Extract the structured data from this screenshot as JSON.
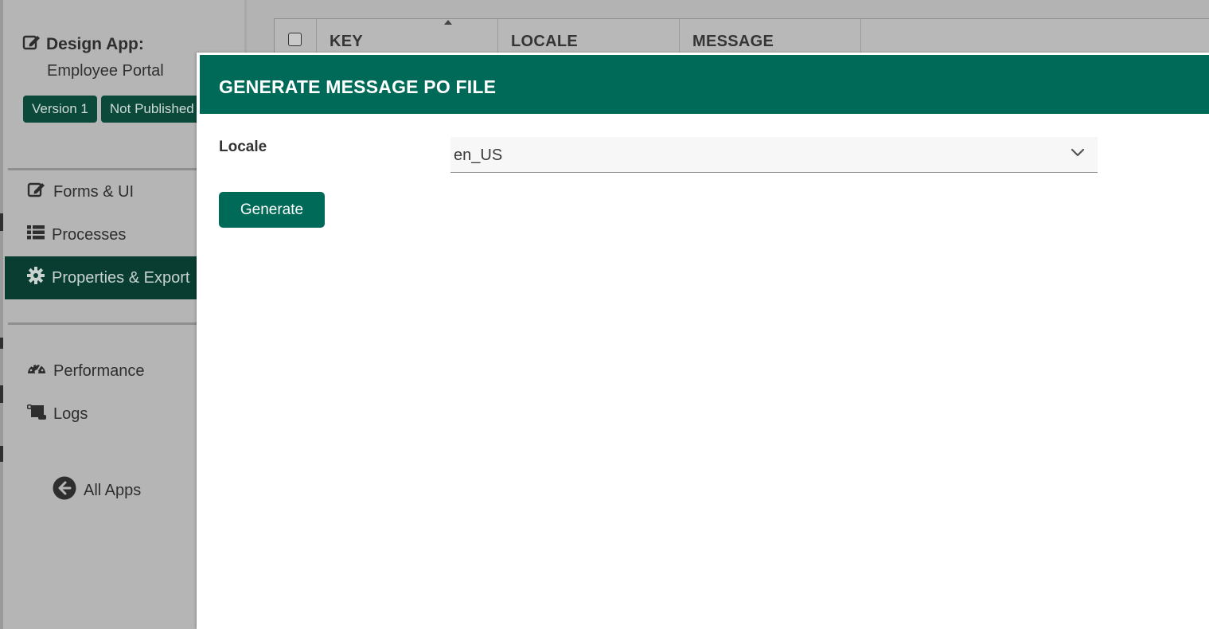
{
  "sidebar": {
    "design_app_label": "Design App:",
    "app_name": "Employee Portal",
    "badges": {
      "version": "Version 1",
      "status": "Not Published"
    },
    "nav": {
      "forms": "Forms & UI",
      "processes": "Processes",
      "properties": "Properties & Export",
      "performance": "Performance",
      "logs": "Logs"
    },
    "all_apps": "All Apps"
  },
  "table": {
    "columns": [
      "KEY",
      "LOCALE",
      "MESSAGE"
    ]
  },
  "modal": {
    "title": "GENERATE MESSAGE PO FILE",
    "locale_label": "Locale",
    "locale_value": "en_US",
    "generate_label": "Generate"
  },
  "colors": {
    "primary": "#006a58",
    "sidebar_active": "#0a3d32",
    "overlay_gray": "#b3b3b3"
  },
  "icons": {
    "design_app": "edit-icon",
    "forms": "edit-icon",
    "processes": "list-icon",
    "properties": "gear-icon",
    "performance": "dashboard-icon",
    "logs": "scroll-icon",
    "all_apps": "arrow-circle-left-icon",
    "select": "chevron-down-icon"
  }
}
